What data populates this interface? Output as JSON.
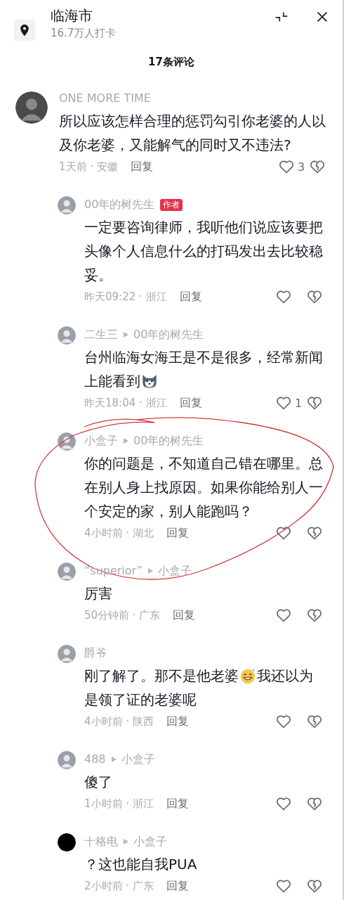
{
  "header": {
    "title": "临海市",
    "subtitle": "16.7万人打卡"
  },
  "comment_count": "17条评论",
  "comments": [
    {
      "author": "ONE MORE TIME",
      "segments": [
        {
          "kind": "text",
          "text": "所以应该怎样合理的惩罚勾引你老婆的人以及你老婆，又能解气的同时又不违法?"
        }
      ],
      "meta": "1天前 · 安徽",
      "reply": "回复",
      "likes": "3",
      "replies": [
        {
          "author": "00年的树先生",
          "author_badge": "作者",
          "segments": [
            {
              "kind": "text",
              "text": "一定要咨询律师，我听他们说应该要把头像个人信息什么的打码发出去比较稳妥。"
            }
          ],
          "meta": "昨天09:22 · 浙江",
          "reply": "回复",
          "circled": false
        },
        {
          "author": "二生三",
          "reply_to": "00年的树先生",
          "segments": [
            {
              "kind": "text",
              "text": "台州临海女海王是不是很多，经常新闻上能看到"
            },
            {
              "kind": "dog"
            }
          ],
          "meta": "昨天18:04 · 浙江",
          "reply": "回复",
          "likes": "1",
          "circled": false
        },
        {
          "author": "小盒子",
          "reply_to": "00年的树先生",
          "segments": [
            {
              "kind": "text",
              "text": "你的问题是，不知道自己错在哪里。总在别人身上找原因。如果你能给别人一个安定的家，别人能跑吗？"
            }
          ],
          "meta": "4小时前 · 湖北",
          "reply": "回复",
          "circled": true
        },
        {
          "author": "“superior”",
          "reply_to": "小盒子",
          "segments": [
            {
              "kind": "text",
              "text": "厉害"
            }
          ],
          "meta": "50分钟前 · 广东",
          "reply": "回复",
          "circled": false
        },
        {
          "author": "爵爷",
          "segments": [
            {
              "kind": "text",
              "text": "刚了解了。那不是他老婆"
            },
            {
              "kind": "grin"
            },
            {
              "kind": "text",
              "text": "我还以为是领了证的老婆呢"
            }
          ],
          "meta": "4小时前 · 陕西",
          "reply": "回复",
          "circled": false
        },
        {
          "author": "488",
          "reply_to": "小盒子",
          "segments": [
            {
              "kind": "text",
              "text": "傻了"
            }
          ],
          "meta": "1小时前 · 浙江",
          "reply": "回复",
          "circled": false
        },
        {
          "author": "十格电",
          "reply_to": "小盒子",
          "segments": [
            {
              "kind": "text",
              "text": "？这也能自我PUA"
            }
          ],
          "meta": "2小时前 · 广东",
          "reply": "回复",
          "circled": false
        }
      ]
    }
  ]
}
